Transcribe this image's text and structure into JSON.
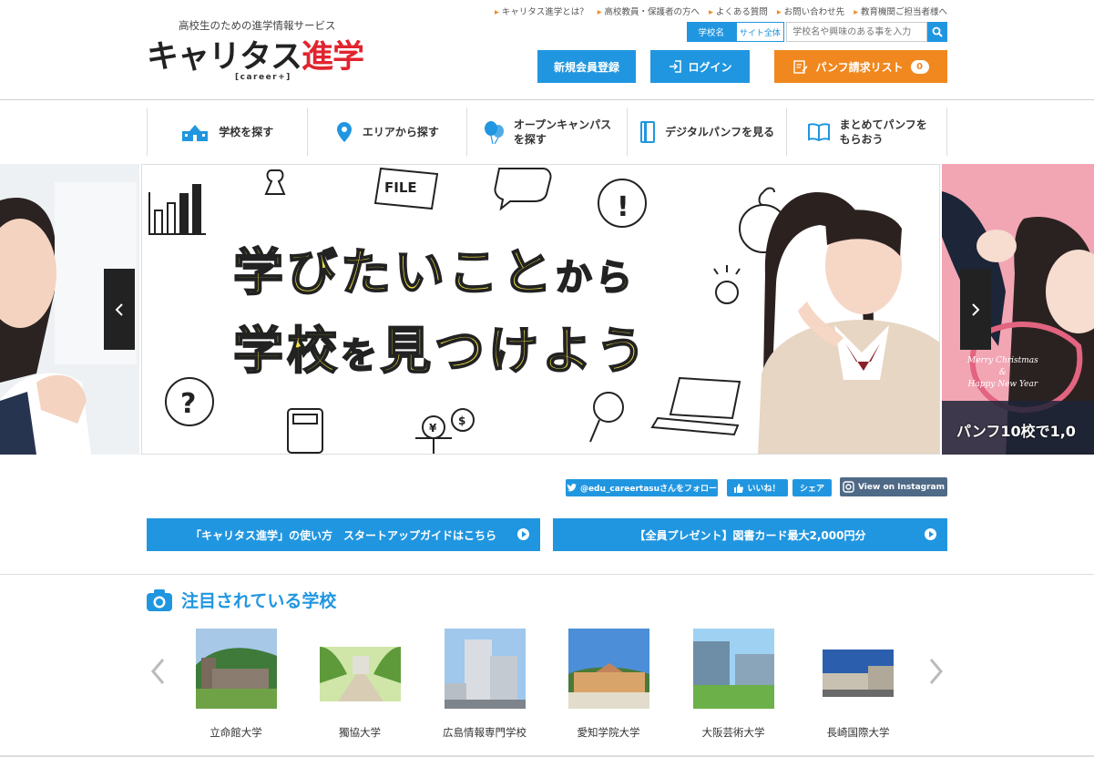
{
  "header": {
    "tagline": "高校生のための進学情報サービス",
    "logo_main": "キャリタス",
    "logo_accent": "進学",
    "logo_sub": "[career+]",
    "top_links": [
      "キャリタス進学とは？",
      "高校教員・保護者の方へ",
      "よくある質問",
      "お問い合わせ先",
      "教育機関ご担当者様へ"
    ],
    "search": {
      "tab_school": "学校名",
      "tab_site": "サイト全体",
      "placeholder": "学校名や興味のある事を入力"
    },
    "register_label": "新規会員登録",
    "login_label": "ログイン",
    "pamphlet_label": "パンフ請求リスト",
    "pamphlet_count": "0"
  },
  "nav": [
    {
      "label": "学校を探す",
      "icon": "school-icon"
    },
    {
      "label": "エリアから探す",
      "icon": "location-pin-icon"
    },
    {
      "label": "オープンキャンパス\nを探す",
      "icon": "balloon-icon"
    },
    {
      "label": "デジタルパンフを見る",
      "icon": "pamphlet-icon"
    },
    {
      "label": "まとめてパンフを\nもらおう",
      "icon": "open-book-icon"
    }
  ],
  "slider": {
    "heading_line1_a": "学びたいこと",
    "heading_line1_b": "から",
    "heading_line2_a": "学校",
    "heading_line2_b": "を",
    "heading_line2_c": "見つけよう",
    "file_label": "FILE",
    "next_slide_greeting_1": "Merry Christmas",
    "next_slide_greeting_amp": "&",
    "next_slide_greeting_2": "Happy New Year",
    "next_slide_banner": "パンフ10校で1,0"
  },
  "social": {
    "twitter": "@edu_careertasuさんをフォロー",
    "like": "いいね！",
    "share": "シェア",
    "instagram": "View on Instagram"
  },
  "wide_buttons": {
    "guide": "「キャリタス進学」の使い方　スタートアップガイドはこちら",
    "present": "【全員プレゼント】図書カード最大2,000円分"
  },
  "featured": {
    "title": "注目されている学校",
    "schools": [
      {
        "name": "立命館大学"
      },
      {
        "name": "獨協大学"
      },
      {
        "name": "広島情報専門学校"
      },
      {
        "name": "愛知学院大学"
      },
      {
        "name": "大阪芸術大学"
      },
      {
        "name": "長崎国際大学"
      }
    ]
  },
  "colors": {
    "brand_blue": "#2196e0",
    "accent_orange": "#f0881f",
    "logo_red": "#e1242e",
    "slide_yellow": "#f7e742"
  }
}
